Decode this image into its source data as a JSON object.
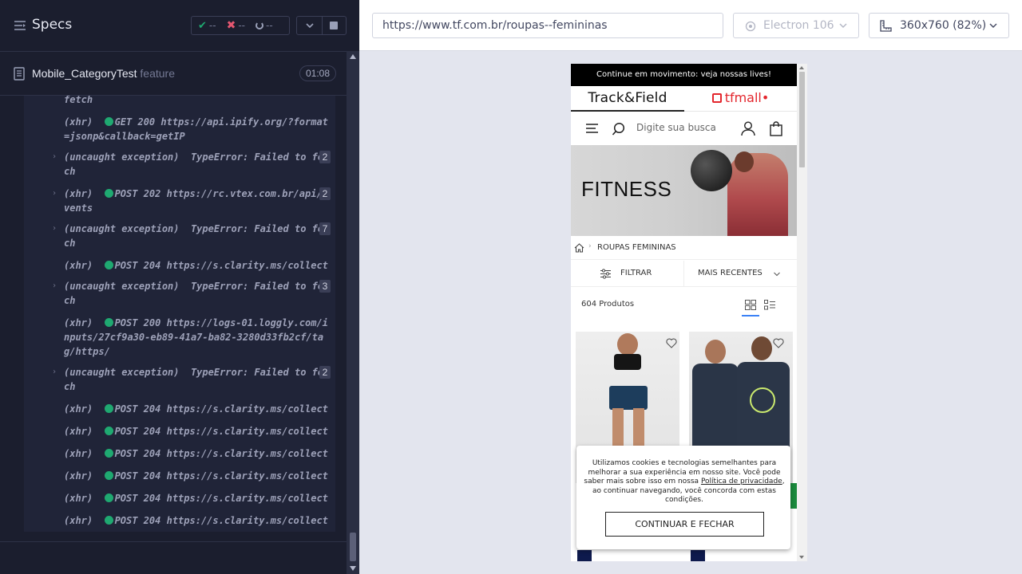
{
  "reporter": {
    "title": "Specs",
    "stats": {
      "passed": "--",
      "failed": "--",
      "pending": "--"
    },
    "spec": {
      "name": "Mobile_CategoryTest",
      "ext": " feature",
      "duration": "01:08"
    },
    "commands": [
      {
        "expandable": false,
        "text": "fetch",
        "count": ""
      },
      {
        "expandable": false,
        "text": "(xhr)  GET 200 https://api.ipify.org/?format=jsonp&callback=getIP",
        "dot": true,
        "prefix": "(xhr)  ",
        "body": "GET 200 https://api.ipify.org/?format=jsonp&callback=getIP",
        "count": ""
      },
      {
        "expandable": true,
        "text": "(uncaught exception)  TypeError: Failed to fetch",
        "count": "2"
      },
      {
        "expandable": true,
        "prefix": "(xhr)  ",
        "body": "POST 202 https://rc.vtex.com.br/api/events",
        "dot": true,
        "count": "2"
      },
      {
        "expandable": true,
        "text": "(uncaught exception)  TypeError: Failed to fetch",
        "count": "7"
      },
      {
        "expandable": false,
        "prefix": "(xhr)  ",
        "body": "POST 204 https://s.clarity.ms/collect",
        "dot": true,
        "count": ""
      },
      {
        "expandable": true,
        "text": "(uncaught exception)  TypeError: Failed to fetch",
        "count": "3"
      },
      {
        "expandable": false,
        "prefix": "(xhr)  ",
        "body": "POST 200 https://logs-01.loggly.com/inputs/27cf9a30-eb89-41a7-ba82-3280d33fb2cf/tag/https/",
        "dot": true,
        "count": ""
      },
      {
        "expandable": true,
        "text": "(uncaught exception)  TypeError: Failed to fetch",
        "count": "2"
      },
      {
        "expandable": false,
        "prefix": "(xhr)  ",
        "body": "POST 204 https://s.clarity.ms/collect",
        "dot": true,
        "count": ""
      },
      {
        "expandable": false,
        "prefix": "(xhr)  ",
        "body": "POST 204 https://s.clarity.ms/collect",
        "dot": true,
        "count": ""
      },
      {
        "expandable": false,
        "prefix": "(xhr)  ",
        "body": "POST 204 https://s.clarity.ms/collect",
        "dot": true,
        "count": ""
      },
      {
        "expandable": false,
        "prefix": "(xhr)  ",
        "body": "POST 204 https://s.clarity.ms/collect",
        "dot": true,
        "count": ""
      },
      {
        "expandable": false,
        "prefix": "(xhr)  ",
        "body": "POST 204 https://s.clarity.ms/collect",
        "dot": true,
        "count": ""
      },
      {
        "expandable": false,
        "prefix": "(xhr)  ",
        "body": "POST 204 https://s.clarity.ms/collect",
        "dot": true,
        "count": ""
      }
    ]
  },
  "preview": {
    "url": "https://www.tf.com.br/roupas--femininas",
    "browser": "Electron 106",
    "viewport": "360x760 (82%)"
  },
  "site": {
    "promo": "Continue em movimento: veja nossas lives!",
    "brand_primary": "Track&Field",
    "brand_secondary": "tfmall",
    "brand_secondary_mark": "•",
    "search_placeholder": "Digite sua busca",
    "hero_title": "FITNESS",
    "breadcrumb": "ROUPAS FEMININAS",
    "filter_label": "FILTRAR",
    "sort_label": "MAIS RECENTES",
    "product_count": "604 Produtos",
    "cookie": {
      "text_before": "Utilizamos cookies e tecnologias semelhantes para melhorar a sua experiência em nosso site. Você pode saber mais sobre isso em nossa ",
      "link": "Política de privacidade",
      "text_after": ", ao continuar navegando, você concorda com estas condições.",
      "button": "CONTINUAR E FECHAR"
    }
  },
  "colors": {
    "reporter_bg": "#1b1e2e",
    "pass": "#1fa971",
    "fail": "#e45770",
    "brand_red": "#e3262d",
    "accent_blue": "#3b82f6"
  }
}
